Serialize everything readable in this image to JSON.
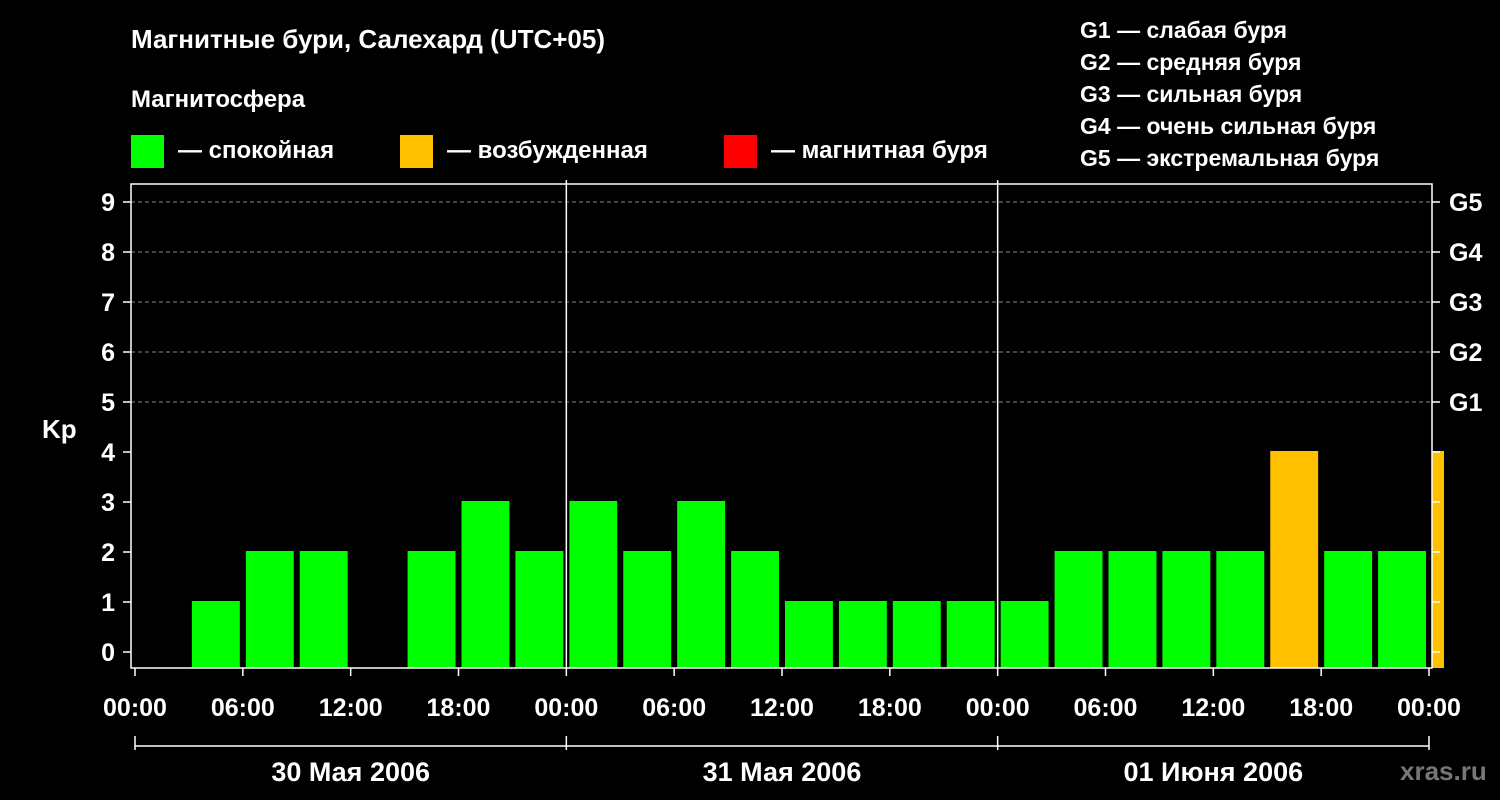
{
  "header": {
    "title": "Магнитные бури, Салехард (UTC+05)",
    "subtitle": "Магнитосфера",
    "legend": [
      {
        "label": "— спокойная",
        "color": "#00ff00"
      },
      {
        "label": "— возбужденная",
        "color": "#ffc000"
      },
      {
        "label": "— магнитная буря",
        "color": "#ff0000"
      }
    ],
    "storm_levels": [
      "G1 — слабая буря",
      "G2 — средняя буря",
      "G3 — сильная буря",
      "G4 — очень сильная буря",
      "G5 — экстремальная буря"
    ]
  },
  "watermark": "xras.ru",
  "chart_data": {
    "type": "bar",
    "ylabel": "Kp",
    "ylim": [
      0,
      9
    ],
    "yticks": [
      0,
      1,
      2,
      3,
      4,
      5,
      6,
      7,
      8,
      9
    ],
    "right_ticks": [
      {
        "kp": 5,
        "label": "G1"
      },
      {
        "kp": 6,
        "label": "G2"
      },
      {
        "kp": 7,
        "label": "G3"
      },
      {
        "kp": 8,
        "label": "G4"
      },
      {
        "kp": 9,
        "label": "G5"
      }
    ],
    "grid": "dashed horizontal at each Kp level from 5 to 9",
    "xtick_labels": [
      "00:00",
      "06:00",
      "12:00",
      "18:00",
      "00:00",
      "06:00",
      "12:00",
      "18:00",
      "00:00",
      "06:00",
      "12:00",
      "18:00",
      "00:00"
    ],
    "days": [
      "30 Мая 2006",
      "31 Мая 2006",
      "01 Июня 2006"
    ],
    "x_unit": "hours from 30 Мая 2006 00:00 (UTC+05)",
    "bars": [
      {
        "start_hour": 0,
        "kp": 0,
        "color": "#00ff00"
      },
      {
        "start_hour": 3,
        "kp": 1,
        "color": "#00ff00"
      },
      {
        "start_hour": 6,
        "kp": 2,
        "color": "#00ff00"
      },
      {
        "start_hour": 9,
        "kp": 2,
        "color": "#00ff00"
      },
      {
        "start_hour": 12,
        "kp": 0,
        "color": "#00ff00"
      },
      {
        "start_hour": 15,
        "kp": 2,
        "color": "#00ff00"
      },
      {
        "start_hour": 18,
        "kp": 3,
        "color": "#00ff00"
      },
      {
        "start_hour": 21,
        "kp": 2,
        "color": "#00ff00"
      },
      {
        "start_hour": 24,
        "kp": 3,
        "color": "#00ff00"
      },
      {
        "start_hour": 27,
        "kp": 2,
        "color": "#00ff00"
      },
      {
        "start_hour": 30,
        "kp": 3,
        "color": "#00ff00"
      },
      {
        "start_hour": 33,
        "kp": 2,
        "color": "#00ff00"
      },
      {
        "start_hour": 36,
        "kp": 1,
        "color": "#00ff00"
      },
      {
        "start_hour": 39,
        "kp": 1,
        "color": "#00ff00"
      },
      {
        "start_hour": 42,
        "kp": 1,
        "color": "#00ff00"
      },
      {
        "start_hour": 45,
        "kp": 1,
        "color": "#00ff00"
      },
      {
        "start_hour": 48,
        "kp": 1,
        "color": "#00ff00"
      },
      {
        "start_hour": 51,
        "kp": 2,
        "color": "#00ff00"
      },
      {
        "start_hour": 54,
        "kp": 2,
        "color": "#00ff00"
      },
      {
        "start_hour": 57,
        "kp": 2,
        "color": "#00ff00"
      },
      {
        "start_hour": 60,
        "kp": 2,
        "color": "#00ff00"
      },
      {
        "start_hour": 63,
        "kp": 4,
        "color": "#ffc000"
      },
      {
        "start_hour": 66,
        "kp": 2,
        "color": "#00ff00"
      },
      {
        "start_hour": 69,
        "kp": 2,
        "color": "#00ff00"
      },
      {
        "start_hour": 72,
        "kp": 4,
        "color": "#ffc000",
        "partial": true
      }
    ]
  }
}
